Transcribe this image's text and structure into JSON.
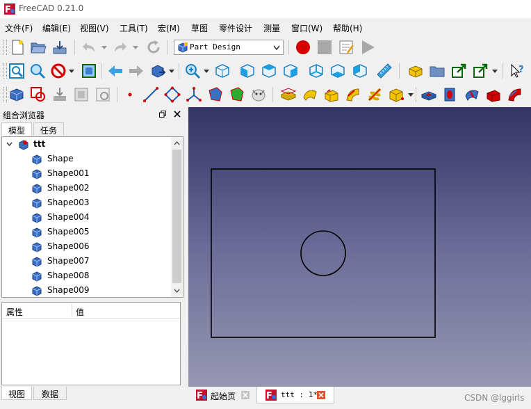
{
  "window": {
    "title": "FreeCAD 0.21.0"
  },
  "menu": [
    "文件(F)",
    "编辑(E)",
    "视图(V)",
    "工具(T)",
    "宏(M)",
    "草图",
    "零件设计",
    "测量",
    "窗口(W)",
    "帮助(H)"
  ],
  "workbench": {
    "selected": "Part Design"
  },
  "combo_view": {
    "title": "组合浏览器",
    "tabs": [
      "模型",
      "任务"
    ],
    "tree": {
      "root": "ttt",
      "children": [
        "Shape",
        "Shape001",
        "Shape002",
        "Shape003",
        "Shape004",
        "Shape005",
        "Shape006",
        "Shape007",
        "Shape008",
        "Shape009"
      ]
    },
    "property_headers": [
      "属性",
      "值"
    ],
    "bottom_tabs": [
      "视图",
      "数据"
    ]
  },
  "documents": [
    {
      "label": "起始页",
      "active": false
    },
    {
      "label": "ttt : 1*",
      "active": true
    }
  ],
  "watermark": "CSDN @lggirls",
  "colors": {
    "viewport_top": "#333366",
    "viewport_bottom": "#9797b3",
    "record": "#d40000"
  },
  "icons": [
    "new-file-icon",
    "open-folder-icon",
    "save-icon",
    "undo-icon",
    "redo-icon",
    "refresh-icon",
    "record-macro-icon",
    "stop-macro-icon",
    "edit-macro-icon",
    "play-macro-icon"
  ]
}
